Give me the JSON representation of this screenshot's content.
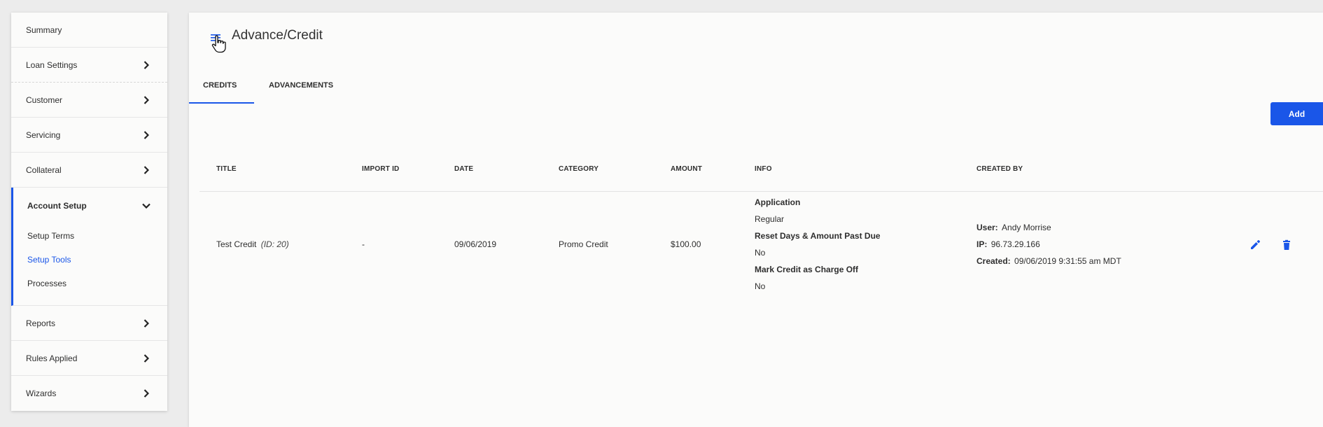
{
  "sidebar": {
    "items_top": [
      {
        "label": "Summary"
      },
      {
        "label": "Loan Settings"
      },
      {
        "label": "Customer"
      },
      {
        "label": "Servicing"
      },
      {
        "label": "Collateral"
      }
    ],
    "active_section": {
      "label": "Account Setup",
      "subitems": [
        {
          "label": "Setup Terms"
        },
        {
          "label": "Setup Tools"
        },
        {
          "label": "Processes"
        }
      ]
    },
    "items_bottom": [
      {
        "label": "Reports"
      },
      {
        "label": "Rules Applied"
      },
      {
        "label": "Wizards"
      }
    ]
  },
  "header": {
    "title": "Advance/Credit",
    "menu_icon": "hamburger-menu-icon",
    "cursor_icon": "hand-pointer-icon"
  },
  "tabs": [
    {
      "label": "CREDITS"
    },
    {
      "label": "ADVANCEMENTS"
    }
  ],
  "toolbar": {
    "add_label": "Add"
  },
  "table": {
    "columns": [
      "TITLE",
      "IMPORT ID",
      "DATE",
      "CATEGORY",
      "AMOUNT",
      "INFO",
      "CREATED BY"
    ],
    "rows": [
      {
        "title": "Test Credit",
        "title_id": "(ID: 20)",
        "import_id": "-",
        "date": "09/06/2019",
        "category": "Promo Credit",
        "amount": "$100.00",
        "info": [
          {
            "label": "Application",
            "value": "Regular"
          },
          {
            "label": "Reset Days & Amount Past Due",
            "value": "No"
          },
          {
            "label": "Mark Credit as Charge Off",
            "value": "No"
          }
        ],
        "created_by": {
          "user_label": "User:",
          "user": "Andy Morrise",
          "ip_label": "IP:",
          "ip": "96.73.29.166",
          "created_label": "Created:",
          "created": "09/06/2019 9:31:55 am MDT"
        }
      }
    ]
  },
  "colors": {
    "accent": "#1a56e8",
    "background": "#ececec",
    "panel": "#fbfbfa"
  }
}
